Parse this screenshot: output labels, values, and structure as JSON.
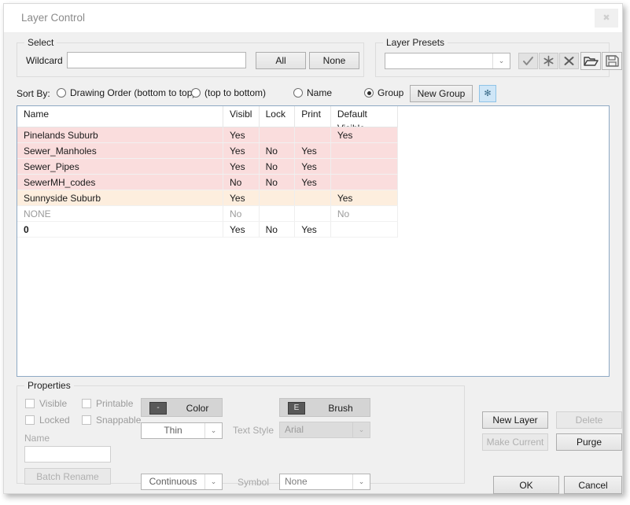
{
  "window": {
    "title": "Layer Control",
    "close_icon": "close-icon",
    "close_glyph": "✖"
  },
  "select_group": {
    "legend": "Select",
    "wildcard_label": "Wildcard",
    "wildcard_value": "",
    "wildcard_placeholder": "",
    "all_button": "All",
    "none_button": "None"
  },
  "presets_group": {
    "legend": "Layer Presets",
    "combo_value": "",
    "buttons": [
      {
        "name": "apply-preset-button",
        "icon": "check-icon",
        "enabled": false
      },
      {
        "name": "new-preset-button",
        "icon": "asterisk-icon",
        "enabled": false
      },
      {
        "name": "delete-preset-button",
        "icon": "x-icon",
        "enabled": false
      },
      {
        "name": "open-preset-button",
        "icon": "folder-open-icon",
        "enabled": true
      },
      {
        "name": "save-preset-button",
        "icon": "save-disk-icon",
        "enabled": true
      }
    ]
  },
  "sort_bar": {
    "label": "Sort By:",
    "options": [
      {
        "label": "Drawing Order (bottom to top)",
        "selected": false
      },
      {
        "label": "(top to bottom)",
        "selected": false
      },
      {
        "label": "Name",
        "selected": false
      },
      {
        "label": "Group",
        "selected": true
      }
    ],
    "new_group_button": "New Group",
    "remove_group_icon": "asterisk-x-icon",
    "remove_group_glyph": "✻"
  },
  "table": {
    "columns": [
      {
        "key": "name",
        "label": "Name",
        "label2": ""
      },
      {
        "key": "visible",
        "label": "Visibl",
        "label2": ""
      },
      {
        "key": "lock",
        "label": "Lock",
        "label2": ""
      },
      {
        "key": "print",
        "label": "Print",
        "label2": ""
      },
      {
        "key": "default",
        "label": "Default",
        "label2": "Visible"
      }
    ],
    "rows": [
      {
        "name": "Pinelands Suburb",
        "visible": "Yes",
        "lock": "",
        "print": "",
        "default": "Yes",
        "style": "grp-pink",
        "indent": 0
      },
      {
        "name": "Sewer_Manholes",
        "visible": "Yes",
        "lock": "No",
        "print": "Yes",
        "default": "",
        "style": "grp-pink",
        "indent": 1
      },
      {
        "name": "Sewer_Pipes",
        "visible": "Yes",
        "lock": "No",
        "print": "Yes",
        "default": "",
        "style": "grp-pink",
        "indent": 1
      },
      {
        "name": "SewerMH_codes",
        "visible": "No",
        "lock": "No",
        "print": "Yes",
        "default": "",
        "style": "grp-pink",
        "indent": 1
      },
      {
        "name": "Sunnyside Suburb",
        "visible": "Yes",
        "lock": "",
        "print": "",
        "default": "Yes",
        "style": "grp-peach",
        "indent": 0
      },
      {
        "name": "NONE",
        "visible": "No",
        "lock": "",
        "print": "",
        "default": "No",
        "style": "grp-none",
        "indent": 0
      },
      {
        "name": "0",
        "visible": "Yes",
        "lock": "No",
        "print": "Yes",
        "default": "",
        "style": "",
        "indent": 2
      }
    ]
  },
  "properties": {
    "legend": "Properties",
    "checkboxes": [
      {
        "label": "Visible",
        "checked": false
      },
      {
        "label": "Printable",
        "checked": false
      },
      {
        "label": "Locked",
        "checked": false
      },
      {
        "label": "Snappable",
        "checked": false
      }
    ],
    "name_label": "Name",
    "name_value": "",
    "batch_rename_button": "Batch Rename",
    "color_button": "Color",
    "color_swatch_glyph": "-",
    "brush_button": "Brush",
    "brush_swatch_glyph": "E",
    "lineweight_value": "Thin",
    "linetype_value": "Continuous",
    "text_style_label": "Text Style",
    "text_style_value": "Arial",
    "symbol_label": "Symbol",
    "symbol_value": "None"
  },
  "actions": {
    "new_layer": "New Layer",
    "delete": "Delete",
    "make_current": "Make Current",
    "purge": "Purge",
    "ok": "OK",
    "cancel": "Cancel"
  }
}
